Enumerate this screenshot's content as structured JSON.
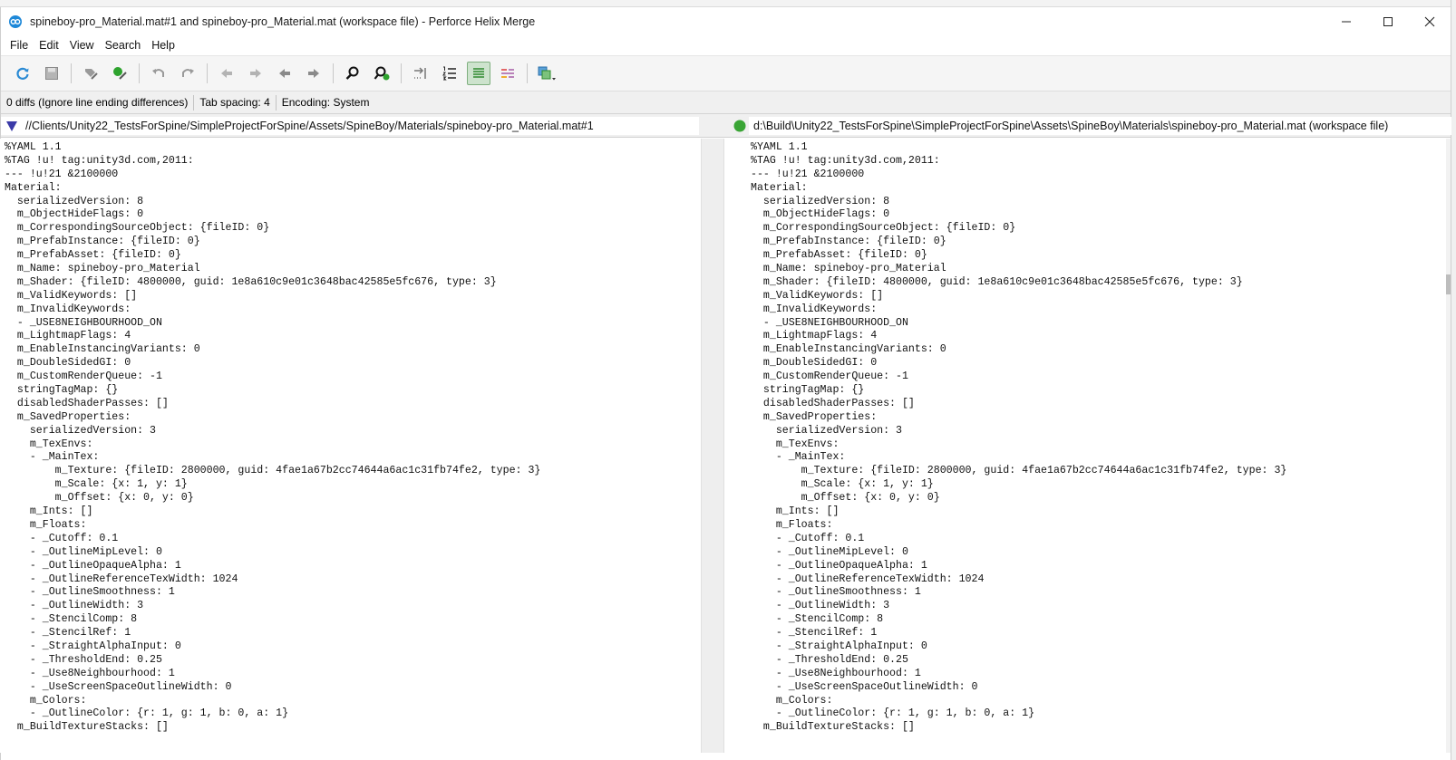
{
  "window": {
    "title": "spineboy-pro_Material.mat#1 and spineboy-pro_Material.mat (workspace file) - Perforce Helix Merge"
  },
  "menu": [
    "File",
    "Edit",
    "View",
    "Search",
    "Help"
  ],
  "toolbar": [
    "refresh-icon",
    "save-icon",
    "edit-icon",
    "check-icon",
    "undo-icon",
    "redo-icon",
    "prev-diff-icon",
    "next-diff-icon",
    "prev-change-icon",
    "next-change-icon",
    "find-icon",
    "find-next-icon",
    "goto-icon",
    "line-numbers-icon",
    "diff-view-icon",
    "highlight-icon",
    "layout-icon"
  ],
  "status": {
    "diffs": "0 diffs (Ignore line ending differences)",
    "tab_spacing": "Tab spacing: 4",
    "encoding": "Encoding: System"
  },
  "paths": {
    "left": "//Clients/Unity22_TestsForSpine/SimpleProjectForSpine/Assets/SpineBoy/Materials/spineboy-pro_Material.mat#1",
    "right": "d:\\Build\\Unity22_TestsForSpine\\SimpleProjectForSpine\\Assets\\SpineBoy\\Materials\\spineboy-pro_Material.mat (workspace file)"
  },
  "colors": {
    "left_marker": "#3b3aa8",
    "right_marker": "#3aa535",
    "refresh": "#2a8ad4",
    "green": "#2ea32e"
  },
  "lines": [
    "%YAML 1.1",
    "%TAG !u! tag:unity3d.com,2011:",
    "--- !u!21 &2100000",
    "Material:",
    "  serializedVersion: 8",
    "  m_ObjectHideFlags: 0",
    "  m_CorrespondingSourceObject: {fileID: 0}",
    "  m_PrefabInstance: {fileID: 0}",
    "  m_PrefabAsset: {fileID: 0}",
    "  m_Name: spineboy-pro_Material",
    "  m_Shader: {fileID: 4800000, guid: 1e8a610c9e01c3648bac42585e5fc676, type: 3}",
    "  m_ValidKeywords: []",
    "  m_InvalidKeywords:",
    "  - _USE8NEIGHBOURHOOD_ON",
    "  m_LightmapFlags: 4",
    "  m_EnableInstancingVariants: 0",
    "  m_DoubleSidedGI: 0",
    "  m_CustomRenderQueue: -1",
    "  stringTagMap: {}",
    "  disabledShaderPasses: []",
    "  m_SavedProperties:",
    "    serializedVersion: 3",
    "    m_TexEnvs:",
    "    - _MainTex:",
    "        m_Texture: {fileID: 2800000, guid: 4fae1a67b2cc74644a6ac1c31fb74fe2, type: 3}",
    "        m_Scale: {x: 1, y: 1}",
    "        m_Offset: {x: 0, y: 0}",
    "    m_Ints: []",
    "    m_Floats:",
    "    - _Cutoff: 0.1",
    "    - _OutlineMipLevel: 0",
    "    - _OutlineOpaqueAlpha: 1",
    "    - _OutlineReferenceTexWidth: 1024",
    "    - _OutlineSmoothness: 1",
    "    - _OutlineWidth: 3",
    "    - _StencilComp: 8",
    "    - _StencilRef: 1",
    "    - _StraightAlphaInput: 0",
    "    - _ThresholdEnd: 0.25",
    "    - _Use8Neighbourhood: 1",
    "    - _UseScreenSpaceOutlineWidth: 0",
    "    m_Colors:",
    "    - _OutlineColor: {r: 1, g: 1, b: 0, a: 1}",
    "  m_BuildTextureStacks: []"
  ]
}
